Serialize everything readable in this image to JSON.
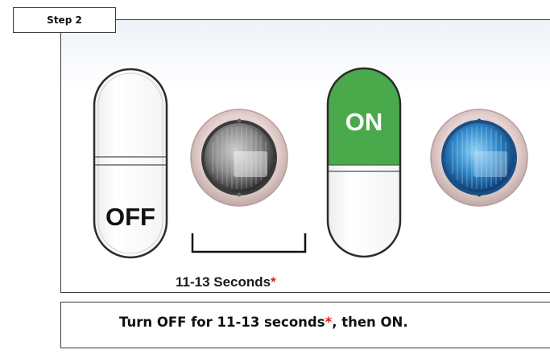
{
  "step_label": "Step 2",
  "switch_off": {
    "label": "OFF"
  },
  "switch_on": {
    "label": "ON",
    "color": "#49a94b"
  },
  "light_off_color": "#7a7a7a",
  "light_on_color": "#2f86c8",
  "duration": {
    "text": "11-13 Seconds",
    "marker": "*"
  },
  "instruction": {
    "before": "Turn OFF for 11-13 seconds",
    "marker": "*",
    "after": ", then ON."
  },
  "marker_color": "#e31b23"
}
